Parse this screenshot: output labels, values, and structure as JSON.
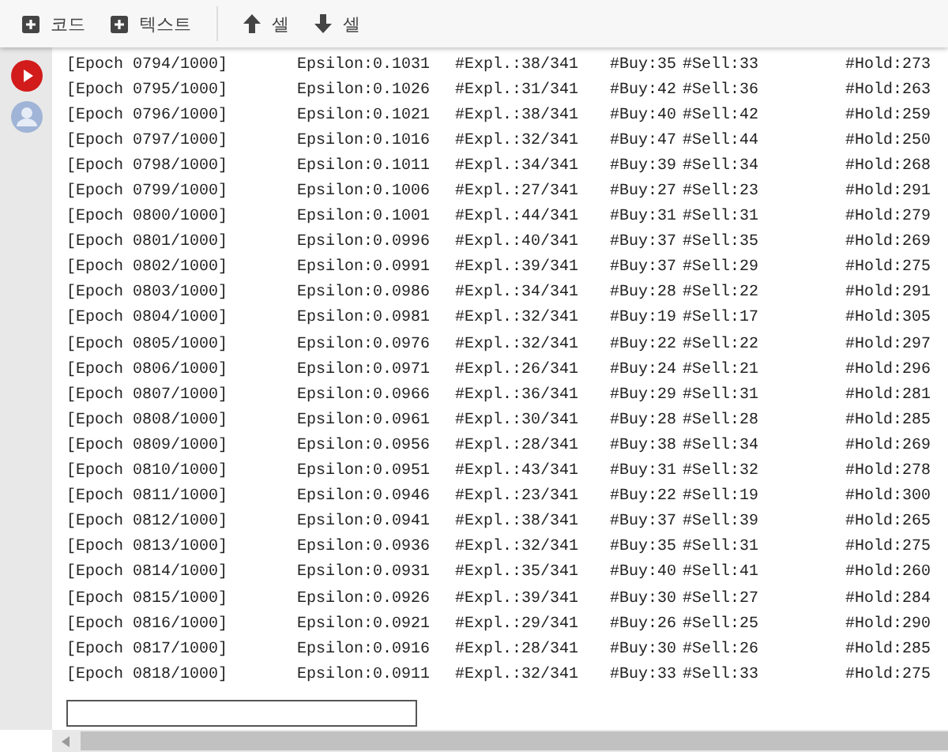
{
  "toolbar": {
    "buttons": [
      {
        "kind": "add",
        "label": "코드"
      },
      {
        "kind": "add",
        "label": "텍스트"
      },
      {
        "kind": "up",
        "label": "셀"
      },
      {
        "kind": "down",
        "label": "셀"
      }
    ]
  },
  "output_lines": [
    {
      "epoch": "[Epoch 0794/1000]",
      "epsilon": "Epsilon:0.1031",
      "expl": "#Expl.:38/341",
      "buy": "#Buy:35",
      "sell": "#Sell:33",
      "hold": "#Hold:273"
    },
    {
      "epoch": "[Epoch 0795/1000]",
      "epsilon": "Epsilon:0.1026",
      "expl": "#Expl.:31/341",
      "buy": "#Buy:42",
      "sell": "#Sell:36",
      "hold": "#Hold:263"
    },
    {
      "epoch": "[Epoch 0796/1000]",
      "epsilon": "Epsilon:0.1021",
      "expl": "#Expl.:38/341",
      "buy": "#Buy:40",
      "sell": "#Sell:42",
      "hold": "#Hold:259"
    },
    {
      "epoch": "[Epoch 0797/1000]",
      "epsilon": "Epsilon:0.1016",
      "expl": "#Expl.:32/341",
      "buy": "#Buy:47",
      "sell": "#Sell:44",
      "hold": "#Hold:250"
    },
    {
      "epoch": "[Epoch 0798/1000]",
      "epsilon": "Epsilon:0.1011",
      "expl": "#Expl.:34/341",
      "buy": "#Buy:39",
      "sell": "#Sell:34",
      "hold": "#Hold:268"
    },
    {
      "epoch": "[Epoch 0799/1000]",
      "epsilon": "Epsilon:0.1006",
      "expl": "#Expl.:27/341",
      "buy": "#Buy:27",
      "sell": "#Sell:23",
      "hold": "#Hold:291"
    },
    {
      "epoch": "[Epoch 0800/1000]",
      "epsilon": "Epsilon:0.1001",
      "expl": "#Expl.:44/341",
      "buy": "#Buy:31",
      "sell": "#Sell:31",
      "hold": "#Hold:279"
    },
    {
      "epoch": "[Epoch 0801/1000]",
      "epsilon": "Epsilon:0.0996",
      "expl": "#Expl.:40/341",
      "buy": "#Buy:37",
      "sell": "#Sell:35",
      "hold": "#Hold:269"
    },
    {
      "epoch": "[Epoch 0802/1000]",
      "epsilon": "Epsilon:0.0991",
      "expl": "#Expl.:39/341",
      "buy": "#Buy:37",
      "sell": "#Sell:29",
      "hold": "#Hold:275"
    },
    {
      "epoch": "[Epoch 0803/1000]",
      "epsilon": "Epsilon:0.0986",
      "expl": "#Expl.:34/341",
      "buy": "#Buy:28",
      "sell": "#Sell:22",
      "hold": "#Hold:291"
    },
    {
      "epoch": "[Epoch 0804/1000]",
      "epsilon": "Epsilon:0.0981",
      "expl": "#Expl.:32/341",
      "buy": "#Buy:19",
      "sell": "#Sell:17",
      "hold": "#Hold:305"
    },
    {
      "epoch": "[Epoch 0805/1000]",
      "epsilon": "Epsilon:0.0976",
      "expl": "#Expl.:32/341",
      "buy": "#Buy:22",
      "sell": "#Sell:22",
      "hold": "#Hold:297"
    },
    {
      "epoch": "[Epoch 0806/1000]",
      "epsilon": "Epsilon:0.0971",
      "expl": "#Expl.:26/341",
      "buy": "#Buy:24",
      "sell": "#Sell:21",
      "hold": "#Hold:296"
    },
    {
      "epoch": "[Epoch 0807/1000]",
      "epsilon": "Epsilon:0.0966",
      "expl": "#Expl.:36/341",
      "buy": "#Buy:29",
      "sell": "#Sell:31",
      "hold": "#Hold:281"
    },
    {
      "epoch": "[Epoch 0808/1000]",
      "epsilon": "Epsilon:0.0961",
      "expl": "#Expl.:30/341",
      "buy": "#Buy:28",
      "sell": "#Sell:28",
      "hold": "#Hold:285"
    },
    {
      "epoch": "[Epoch 0809/1000]",
      "epsilon": "Epsilon:0.0956",
      "expl": "#Expl.:28/341",
      "buy": "#Buy:38",
      "sell": "#Sell:34",
      "hold": "#Hold:269"
    },
    {
      "epoch": "[Epoch 0810/1000]",
      "epsilon": "Epsilon:0.0951",
      "expl": "#Expl.:43/341",
      "buy": "#Buy:31",
      "sell": "#Sell:32",
      "hold": "#Hold:278"
    },
    {
      "epoch": "[Epoch 0811/1000]",
      "epsilon": "Epsilon:0.0946",
      "expl": "#Expl.:23/341",
      "buy": "#Buy:22",
      "sell": "#Sell:19",
      "hold": "#Hold:300"
    },
    {
      "epoch": "[Epoch 0812/1000]",
      "epsilon": "Epsilon:0.0941",
      "expl": "#Expl.:38/341",
      "buy": "#Buy:37",
      "sell": "#Sell:39",
      "hold": "#Hold:265"
    },
    {
      "epoch": "[Epoch 0813/1000]",
      "epsilon": "Epsilon:0.0936",
      "expl": "#Expl.:32/341",
      "buy": "#Buy:35",
      "sell": "#Sell:31",
      "hold": "#Hold:275"
    },
    {
      "epoch": "[Epoch 0814/1000]",
      "epsilon": "Epsilon:0.0931",
      "expl": "#Expl.:35/341",
      "buy": "#Buy:40",
      "sell": "#Sell:41",
      "hold": "#Hold:260"
    },
    {
      "epoch": "[Epoch 0815/1000]",
      "epsilon": "Epsilon:0.0926",
      "expl": "#Expl.:39/341",
      "buy": "#Buy:30",
      "sell": "#Sell:27",
      "hold": "#Hold:284"
    },
    {
      "epoch": "[Epoch 0816/1000]",
      "epsilon": "Epsilon:0.0921",
      "expl": "#Expl.:29/341",
      "buy": "#Buy:26",
      "sell": "#Sell:25",
      "hold": "#Hold:290"
    },
    {
      "epoch": "[Epoch 0817/1000]",
      "epsilon": "Epsilon:0.0916",
      "expl": "#Expl.:28/341",
      "buy": "#Buy:30",
      "sell": "#Sell:26",
      "hold": "#Hold:285"
    },
    {
      "epoch": "[Epoch 0818/1000]",
      "epsilon": "Epsilon:0.0911",
      "expl": "#Expl.:32/341",
      "buy": "#Buy:33",
      "sell": "#Sell:33",
      "hold": "#Hold:275"
    }
  ]
}
